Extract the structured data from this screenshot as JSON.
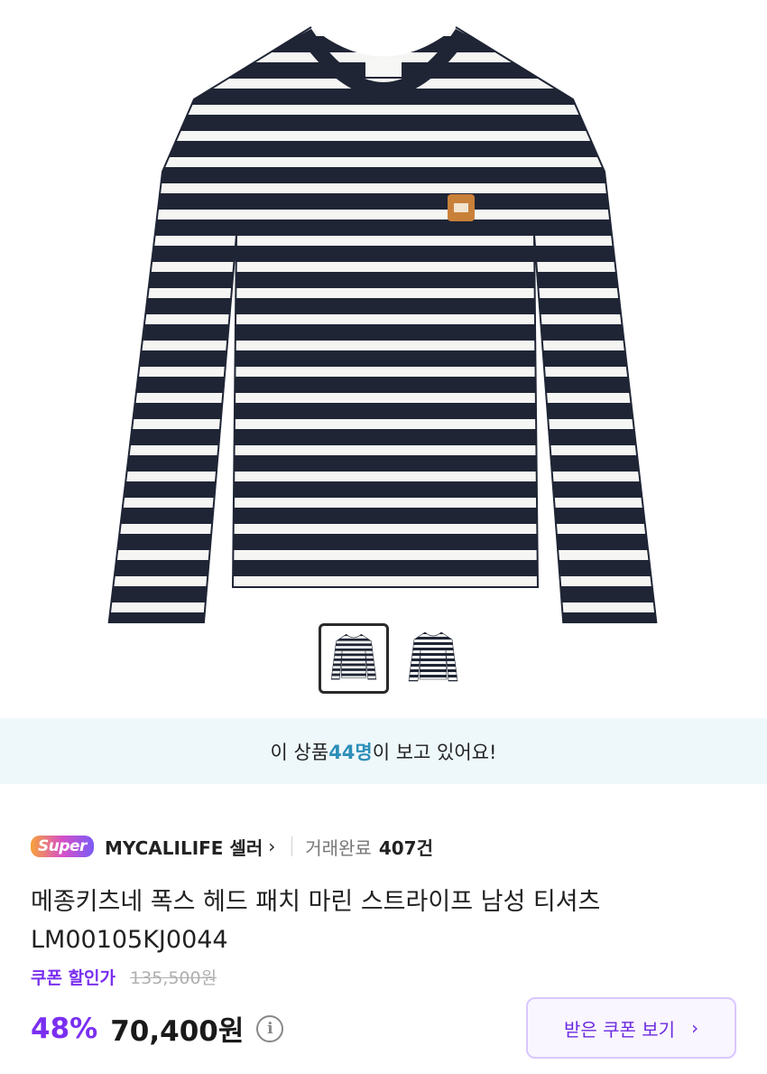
{
  "viewers": {
    "prefix": "이 상품 ",
    "count": "44명",
    "suffix": "이 보고 있어요!"
  },
  "seller": {
    "badge": "Super",
    "name": "MYCALILIFE 셀러",
    "arrow": "›",
    "trade_label": "거래완료",
    "trade_count": "407건"
  },
  "product": {
    "title": "메종키츠네 폭스 헤드 패치 마린 스트라이프 남성 티셔츠 LM00105KJ0044",
    "coupon_label": "쿠폰 할인가",
    "original_price": "135,500원",
    "discount": "48%",
    "price": "70,400원",
    "info_icon": "i"
  },
  "coupon_button": {
    "label": "받은 쿠폰 보기",
    "chevron": "›"
  },
  "colors": {
    "navy": "#1f2535",
    "accent": "#7a2ff0",
    "viewer_bg": "#eef8fb",
    "viewer_count": "#2e8fb8"
  }
}
